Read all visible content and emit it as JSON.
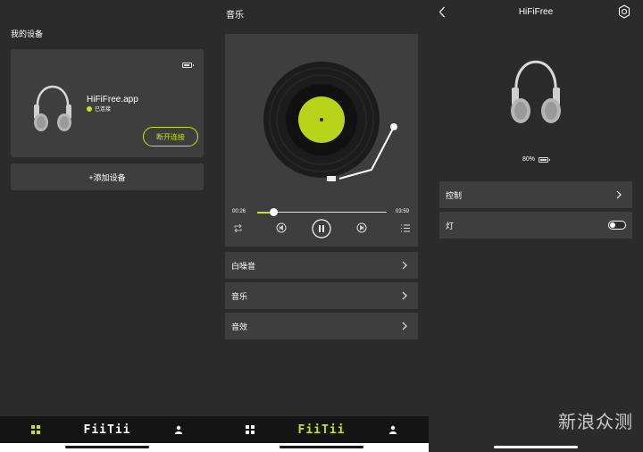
{
  "colors": {
    "accent": "#c4e513",
    "panel_bg": "#2b2b2c",
    "card_bg": "#3e3e3f",
    "tabbar_bg": "#141414"
  },
  "devices_screen": {
    "title": "我的设备",
    "device": {
      "name": "HiFiFree.app",
      "status": "已连接",
      "disconnect_label": "断开连接",
      "image_icon": "headphones-icon",
      "battery_icon": "battery-icon"
    },
    "add_device_label": "+添加设备"
  },
  "music_screen": {
    "title": "音乐",
    "current_time": "00:26",
    "total_time": "03:59",
    "progress": 0.13,
    "controls": [
      "repeat-icon",
      "previous-icon",
      "pause-icon",
      "next-icon",
      "playlist-icon"
    ],
    "menu": [
      {
        "label": "白噪音"
      },
      {
        "label": "音乐"
      },
      {
        "label": "音效"
      }
    ]
  },
  "detail_screen": {
    "title": "HiFiFree",
    "battery": "80%",
    "rows": [
      {
        "label": "控制"
      },
      {
        "label": "灯"
      }
    ],
    "light_on": false
  },
  "tabbar": {
    "logo": "FiiTii",
    "icons": [
      "grid-icon",
      "person-icon"
    ]
  },
  "watermark": "新浪众测"
}
